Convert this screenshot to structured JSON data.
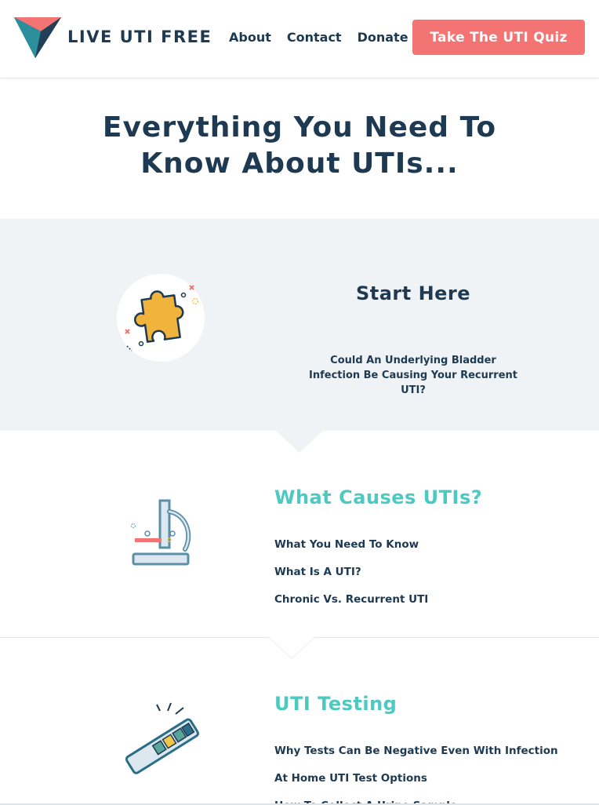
{
  "header": {
    "logo_text": "LIVE UTI FREE",
    "nav": [
      "About",
      "Contact",
      "Donate"
    ],
    "cta_label": "Take The UTI Quiz"
  },
  "hero": {
    "title": "Everything You Need To Know About UTIs..."
  },
  "start_here": {
    "title": "Start Here",
    "link": "Could An Underlying Bladder Infection Be Causing Your Recurrent UTI?"
  },
  "sections": [
    {
      "title": "What Causes UTIs?",
      "links": [
        "What You Need To Know",
        "What Is A UTI?",
        "Chronic Vs. Recurrent UTI"
      ]
    },
    {
      "title": "UTI Testing",
      "links": [
        "Why Tests Can Be Negative Even With Infection",
        "At Home UTI Test Options",
        "How To Collect A Urine Sample"
      ]
    }
  ],
  "colors": {
    "navy": "#1d3a52",
    "teal": "#4cc9c0",
    "coral": "#f47373",
    "band": "#eff3f5"
  }
}
